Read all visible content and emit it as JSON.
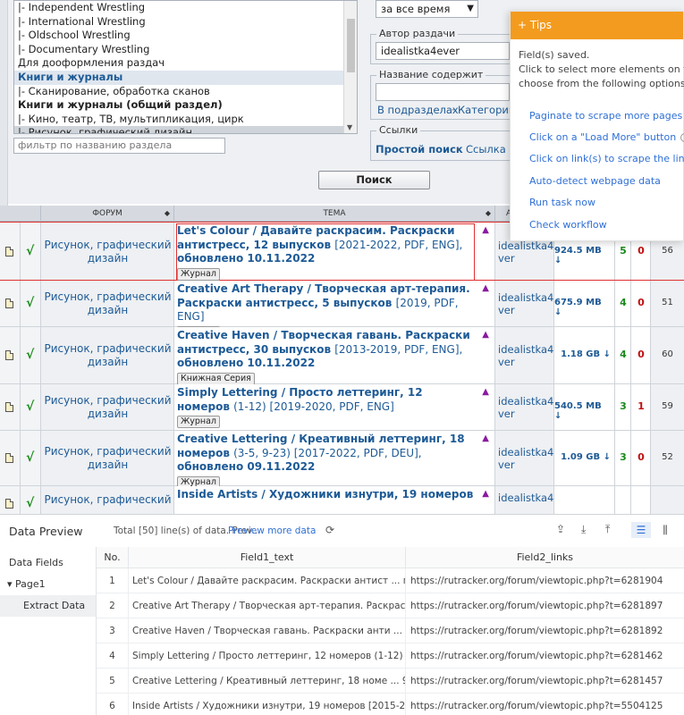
{
  "forum_list": {
    "items": [
      {
        "label": "|- Independent Wrestling",
        "kind": "item"
      },
      {
        "label": "|- International Wrestling",
        "kind": "item"
      },
      {
        "label": "|- Oldschool Wrestling",
        "kind": "item"
      },
      {
        "label": "|- Documentary Wrestling",
        "kind": "item"
      },
      {
        "label": "Для дооформления раздач",
        "kind": "item"
      },
      {
        "label": "Книги и журналы",
        "kind": "cat"
      },
      {
        "label": "|- Сканирование, обработка сканов",
        "kind": "item"
      },
      {
        "label": "Книги и журналы (общий раздел)",
        "kind": "sub"
      },
      {
        "label": "|- Кино, театр, ТВ, мультипликация, цирк",
        "kind": "item"
      },
      {
        "label": "|- Рисунок, графический дизайн",
        "kind": "sel"
      }
    ],
    "filter_placeholder": "фильтр по названию раздела"
  },
  "search_form": {
    "period_value": "за все время",
    "author_legend": "Автор раздачи",
    "author_value": "idealistka4ever",
    "title_legend": "Название содержит",
    "title_value": "",
    "in_subsections": "В подразделах",
    "categories": "Категории",
    "links_legend": "Ссылки",
    "simple_search": "Простой поиск",
    "link_to": "Ссылка на",
    "search_button": "Поиск"
  },
  "table": {
    "headers": {
      "forum": "ФОРУМ",
      "topic": "ТЕМА",
      "author": "А"
    },
    "rows": [
      {
        "forum": "Рисунок, графический дизайн",
        "title": "Let's Colour / Давайте раскрасим. Раскраски антистресс, 12 выпусков",
        "meta": "[2021-2022, PDF, ENG],",
        "title2": "обновлено 10.11.2022",
        "tag": "Журнал",
        "author": "idealistka4e ver",
        "size": "924.5 MB ↓",
        "seeds": "5",
        "leech": "0",
        "dl": "56"
      },
      {
        "forum": "Рисунок, графический дизайн",
        "title": "Creative Art Therapy / Творческая арт-терапия. Раскраски антистресс, 5 выпусков",
        "meta": "[2019, PDF, ENG]",
        "title2": "",
        "tag": "Журнал",
        "author": "idealistka4e ver",
        "size": "675.9 MB ↓",
        "seeds": "4",
        "leech": "0",
        "dl": "51"
      },
      {
        "forum": "Рисунок, графический дизайн",
        "title": "Creative Haven / Творческая гавань. Раскраски антистресс, 30 выпусков",
        "meta": "[2013-2019, PDF, ENG],",
        "title2": "обновлено 10.11.2022",
        "tag": "Книжная Серия",
        "author": "idealistka4e ver",
        "size": "1.18 GB ↓",
        "seeds": "4",
        "leech": "0",
        "dl": "60"
      },
      {
        "forum": "Рисунок, графический дизайн",
        "title": "Simply Lettering / Просто леттеринг, 12 номеров",
        "meta": "(1-12) [2019-2020, PDF, ENG]",
        "title2": "",
        "tag": "Журнал",
        "author": "idealistka4e ver",
        "size": "540.5 MB ↓",
        "seeds": "3",
        "leech": "1",
        "dl": "59"
      },
      {
        "forum": "Рисунок, графический дизайн",
        "title": "Creative Lettering / Креативный леттеринг, 18 номеров",
        "meta": "(3-5, 9-23) [2017-2022, PDF, DEU],",
        "title2": "обновлено 09.11.2022",
        "tag": "Журнал",
        "author": "idealistka4e ver",
        "size": "1.09 GB ↓",
        "seeds": "3",
        "leech": "0",
        "dl": "52"
      },
      {
        "forum": "Рисунок, графический",
        "title": "Inside Artists / Художники изнутри, 19 номеров",
        "meta": "",
        "title2": "",
        "tag": "",
        "author": "idealistka4e",
        "size": "",
        "seeds": "",
        "leech": "",
        "dl": ""
      }
    ]
  },
  "tips": {
    "header": "Tips",
    "msg1": "Field(s) saved.",
    "msg2": "Click to select more elements on the pa",
    "msg3": "choose from the following options.",
    "options": [
      "Paginate to scrape more pages",
      "Click on a \"Load More\" button",
      "Click on link(s) to scrape the linked p",
      "Auto-detect webpage data",
      "Run task now",
      "Check workflow"
    ]
  },
  "preview": {
    "title": "Data Preview",
    "total": "Total [50] line(s) of data. Prev...",
    "more": "Preview more data",
    "side": {
      "fields": "Data Fields",
      "page": "Page1",
      "extract": "Extract Data"
    },
    "columns": {
      "no": "No.",
      "field1": "Field1_text",
      "field2": "Field2_links"
    },
    "rows": [
      {
        "no": "1",
        "text": "Let's Colour / Давайте раскрасим. Раскраски антист ... пуско...",
        "link": "https://rutracker.org/forum/viewtopic.php?t=6281904"
      },
      {
        "no": "2",
        "text": "Creative Art Therapy / Творческая арт-терапия. Раскраски ан...",
        "link": "https://rutracker.org/forum/viewtopic.php?t=6281897"
      },
      {
        "no": "3",
        "text": "Creative Haven / Творческая гавань. Раскраски анти ... пуско...",
        "link": "https://rutracker.org/forum/viewtopic.php?t=6281892"
      },
      {
        "no": "4",
        "text": "Simply Lettering / Просто леттеринг, 12 номеров (1-12) [201...",
        "link": "https://rutracker.org/forum/viewtopic.php?t=6281462"
      },
      {
        "no": "5",
        "text": "Creative Lettering / Креативный леттеринг, 18 номе ... 9-23) ...",
        "link": "https://rutracker.org/forum/viewtopic.php?t=6281457"
      },
      {
        "no": "6",
        "text": "Inside Artists / Художники изнутри, 19 номеров [2015-2021,...",
        "link": "https://rutracker.org/forum/viewtopic.php?t=5504125"
      }
    ]
  }
}
